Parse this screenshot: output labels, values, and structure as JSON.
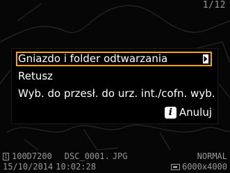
{
  "frame_counter": "1/12",
  "menu": {
    "items": [
      {
        "label": "Gniazdo i folder odtwarzania"
      },
      {
        "label": "Retusz"
      },
      {
        "label": "Wyb. do przesł. do urz. int./cofn. wyb."
      }
    ],
    "cancel_label": "Anuluj",
    "info_icon_glyph": "i"
  },
  "status": {
    "card_slot": "1",
    "folder": "100D7200",
    "filename": "DSC_0001.",
    "extension": "JPG",
    "quality": "NORMAL",
    "date": "15/10/2014",
    "time": "10:02:28",
    "dimensions": "6000x4000"
  },
  "colors": {
    "selection_border": "#f2a51a",
    "text": "#ffffff",
    "status_text": "#9a9a9a"
  }
}
